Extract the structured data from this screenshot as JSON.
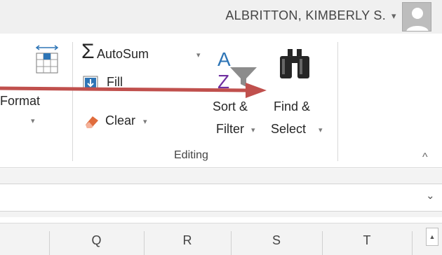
{
  "account": {
    "name": "ALBRITTON, KIMBERLY S.",
    "caret": "▾"
  },
  "ribbon": {
    "format": {
      "label": "Format",
      "caret": "▾"
    },
    "autosum": {
      "symbol": "Σ",
      "label": "AutoSum",
      "caret": "▾"
    },
    "fill": {
      "label": "Fill",
      "caret": "▾"
    },
    "clear": {
      "label": "Clear",
      "caret": "▾"
    },
    "sort_filter": {
      "line1": "Sort &",
      "line2": "Filter",
      "caret": "▾"
    },
    "find_select": {
      "line1": "Find &",
      "line2": "Select",
      "caret": "▾"
    },
    "group_label": "Editing",
    "collapse": "^"
  },
  "formula_bar": {
    "dropdown": "⌄"
  },
  "columns": [
    "Q",
    "R",
    "S",
    "T"
  ],
  "scrollbar": {
    "up": "▲"
  },
  "annotation": {
    "arrow_color": "#c0504d"
  },
  "colors": {
    "autosum": "#262626",
    "sort_a": "#2e75b6",
    "sort_z": "#7030a0",
    "clear": "#e06c3c"
  }
}
